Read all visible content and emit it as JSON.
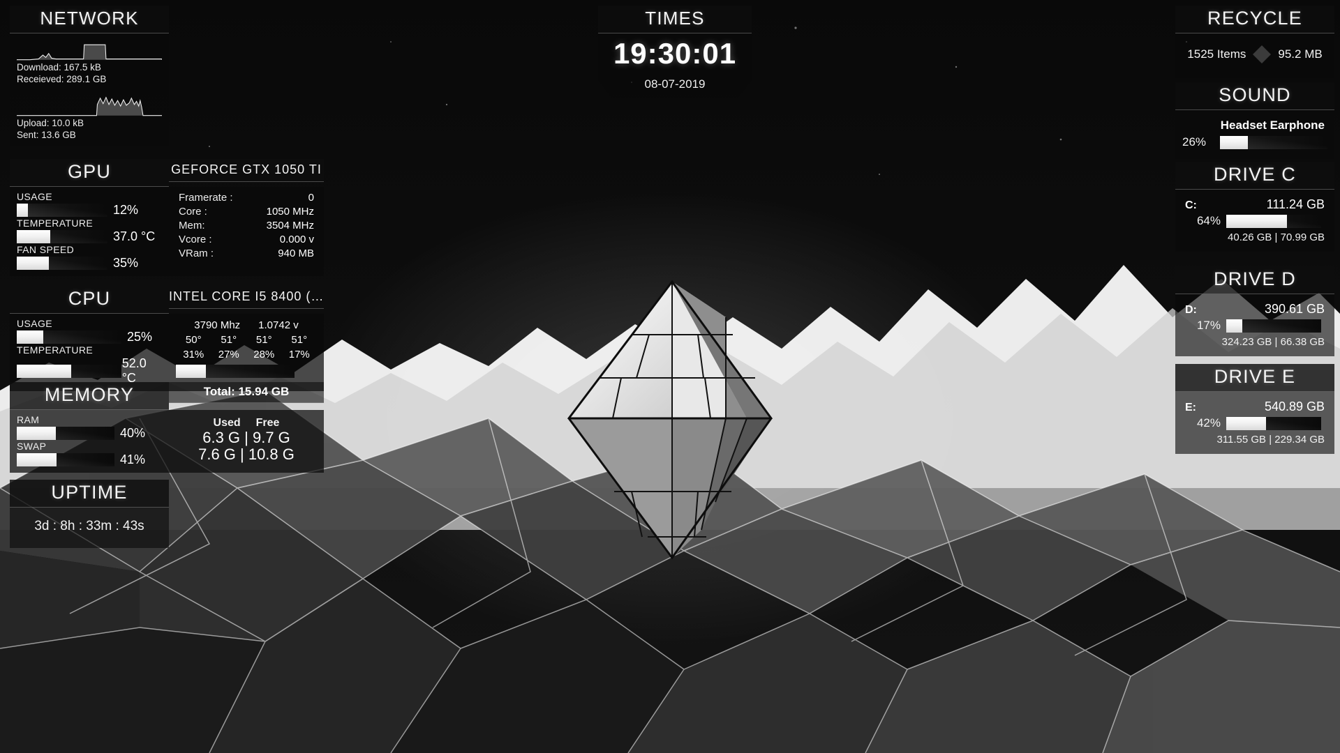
{
  "network": {
    "title": "NETWORK",
    "download_label": "Download: 167.5 kB",
    "received_label": "Receieved: 289.1 GB",
    "upload_label": "Upload: 10.0 kB",
    "sent_label": "Sent: 13.6 GB",
    "download_graph": "0,28 18,28 30,27 36,22 40,25 44,20 48,26 54,27 92,27 93,9 122,9 123,27 200,27 200,28",
    "upload_graph": "0,28 110,28 111,14 115,6 119,13 123,5 127,14 131,7 135,15 139,9 143,16 147,8 151,15 155,12 158,6 162,14 165,10 168,16 170,9 172,17 174,28 200,28"
  },
  "gpu": {
    "title": "GPU",
    "model": "GEFORCE GTX 1050 TI",
    "bars": [
      {
        "label": "USAGE",
        "percent": 12,
        "value": "12%"
      },
      {
        "label": "TEMPERATURE",
        "percent": 37,
        "value": "37.0 °C"
      },
      {
        "label": "FAN SPEED",
        "percent": 35,
        "value": "35%"
      }
    ],
    "details": [
      {
        "key": "Framerate :",
        "value": "0"
      },
      {
        "key": "Core :",
        "value": "1050 MHz"
      },
      {
        "key": "Mem:",
        "value": "3504 MHz"
      },
      {
        "key": "Vcore :",
        "value": "0.000 v"
      },
      {
        "key": "VRam :",
        "value": "940 MB"
      }
    ]
  },
  "cpu": {
    "title": "CPU",
    "model": "INTEL CORE I5 8400 (…",
    "bars": [
      {
        "label": "USAGE",
        "percent": 25,
        "value": "25%"
      },
      {
        "label": "TEMPERATURE",
        "percent": 52,
        "value": "52.0 °C"
      }
    ],
    "frequency": "3790 Mhz",
    "voltage": "1.0742 v",
    "core_temps": [
      "50°",
      "51°",
      "51°",
      "51°"
    ],
    "core_loads": [
      "31%",
      "27%",
      "28%",
      "17%"
    ],
    "total_bar_percent": 25
  },
  "memory": {
    "title": "MEMORY",
    "total_label": "Total: 15.94 GB",
    "bars": [
      {
        "label": "RAM",
        "percent": 40,
        "value": "40%"
      },
      {
        "label": "SWAP",
        "percent": 41,
        "value": "41%"
      }
    ],
    "header_used": "Used",
    "header_free": "Free",
    "ram_line": "6.3 G | 9.7 G",
    "swap_line": "7.6 G | 10.8 G"
  },
  "uptime": {
    "title": "UPTIME",
    "value": "3d : 8h : 33m : 43s"
  },
  "times": {
    "title": "TIMES",
    "clock": "19:30:01",
    "date": "08-07-2019"
  },
  "recycle": {
    "title": "RECYCLE",
    "items": "1525 Items",
    "size": "95.2 MB"
  },
  "sound": {
    "title": "SOUND",
    "device": "Headset Earphone",
    "percent": 26,
    "volume": "26%"
  },
  "drives": [
    {
      "title": "DRIVE C",
      "letter": "C:",
      "capacity": "111.24 GB",
      "percent": 64,
      "percent_label": "64%",
      "detail": "40.26 GB | 70.99 GB"
    },
    {
      "title": "DRIVE D",
      "letter": "D:",
      "capacity": "390.61 GB",
      "percent": 17,
      "percent_label": "17%",
      "detail": "324.23 GB | 66.38 GB"
    },
    {
      "title": "DRIVE E",
      "letter": "E:",
      "capacity": "540.89 GB",
      "percent": 42,
      "percent_label": "42%",
      "detail": "311.55 GB | 229.34 GB"
    }
  ],
  "colors": {
    "accent": "#ffffff",
    "panel": "#0a0a0a",
    "text": "#f2f2f2"
  }
}
